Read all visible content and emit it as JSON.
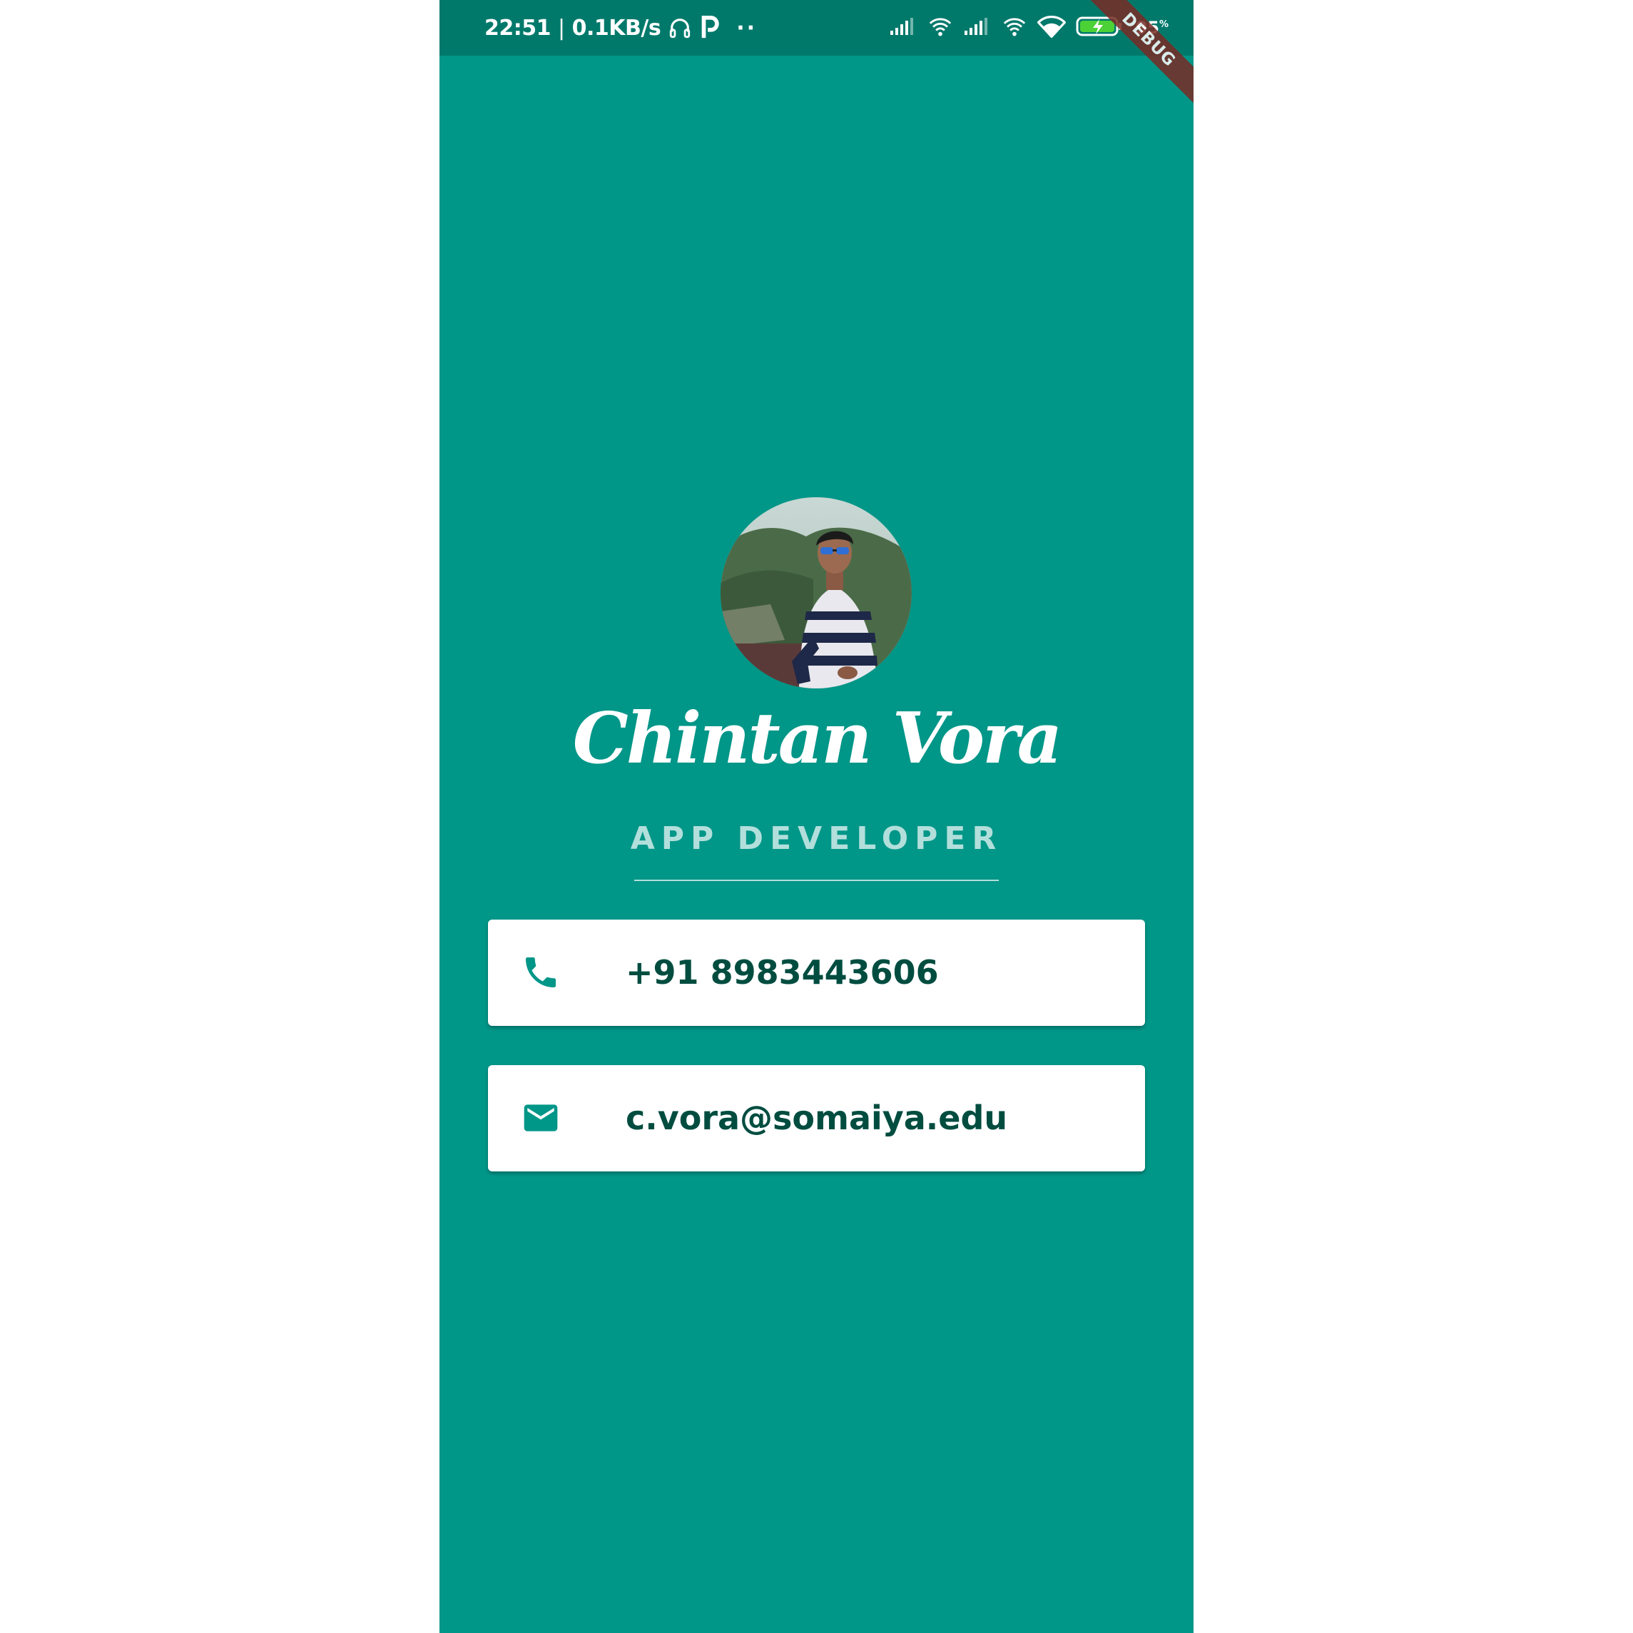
{
  "status_bar": {
    "time": "22:51",
    "separator": "|",
    "network_speed": "0.1KB/s",
    "dots": "··",
    "battery_level": "95",
    "battery_unit": "%",
    "icons": [
      "headphones-icon",
      "parking-icon",
      "signal-icon",
      "wifi-calling-icon",
      "signal-icon",
      "wifi-calling-icon",
      "wifi-icon",
      "battery-charging-icon"
    ]
  },
  "debug_banner": "DEBUG",
  "profile": {
    "name": "Chintan Vora",
    "title": "APP DEVELOPER",
    "avatar_icon": "profile-photo"
  },
  "contacts": {
    "phone": {
      "icon": "phone-icon",
      "value": "+91 8983443606"
    },
    "email": {
      "icon": "mail-icon",
      "value": "c.vora@somaiya.edu"
    }
  },
  "colors": {
    "background": "#009688",
    "status_bar": "#00796b",
    "title_text": "#b2dfdb",
    "card_text": "#004d40",
    "icon": "#009688",
    "debug_ribbon": "#7a2b25"
  }
}
